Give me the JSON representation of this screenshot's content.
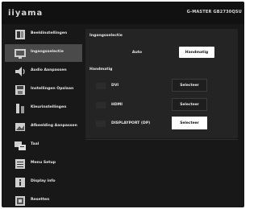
{
  "brand": {
    "logo_text": "iiyama",
    "model": "G-MASTER GB2730QSU"
  },
  "sidebar": {
    "items": [
      {
        "label": "Beeldinstellingen",
        "icon": "picture-settings-icon"
      },
      {
        "label": "Ingangsselectie",
        "icon": "input-select-icon",
        "active": true
      },
      {
        "label": "Audio Aanpassen",
        "icon": "audio-icon"
      },
      {
        "label": "Instellingen Opslaan",
        "icon": "save-settings-icon"
      },
      {
        "label": "Kleurinstellingen",
        "icon": "color-settings-icon"
      },
      {
        "label": "Afbeelding Aanpassen",
        "icon": "image-adjust-icon"
      },
      {
        "label": "Taal",
        "icon": "language-icon"
      },
      {
        "label": "Menu Setup",
        "icon": "menu-setup-icon"
      },
      {
        "label": "Display info",
        "icon": "display-info-icon"
      },
      {
        "label": "Resetten",
        "icon": "reset-icon"
      }
    ]
  },
  "main": {
    "section1_title": "Ingangsselectie",
    "mode_options": [
      {
        "label": "Auto",
        "selected": false
      },
      {
        "label": "Handmatig",
        "selected": true
      }
    ],
    "section2_title": "Handmatig",
    "inputs": [
      {
        "label": "DVI",
        "button": "Selecteer",
        "selected": false
      },
      {
        "label": "HDMI",
        "button": "Selecteer",
        "selected": false
      },
      {
        "label": "DISPLAYPORT (DP)",
        "button": "Selecteer",
        "selected": true
      }
    ]
  },
  "colors": {
    "background": "#181818",
    "active_item": "#4a4a4a",
    "panel": "#242424",
    "highlight": "#ffffff"
  }
}
